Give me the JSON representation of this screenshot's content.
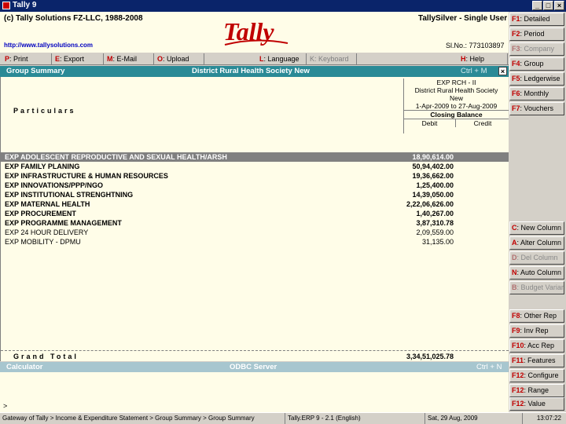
{
  "window": {
    "title": "Tally 9"
  },
  "header": {
    "copyright": "(c) Tally Solutions FZ-LLC, 1988-2008",
    "product": "TallySilver - Single User",
    "website": "http://www.tallysolutions.com",
    "serial": "Sl.No.: 773103897",
    "logo_text": "Tally"
  },
  "menu": [
    {
      "key": "P",
      "label": ": Print",
      "dim": false
    },
    {
      "key": "E",
      "label": ": Export",
      "dim": false
    },
    {
      "key": "M",
      "label": ": E-Mail",
      "dim": false
    },
    {
      "key": "O",
      "label": ": Upload",
      "dim": false
    },
    {
      "key": "L",
      "label": ": Language",
      "dim": false
    },
    {
      "key": "K",
      "label": ": Keyboard",
      "dim": true
    },
    {
      "key": "H",
      "label": ": Help",
      "dim": false
    }
  ],
  "report": {
    "title": "Group Summary",
    "company": "District Rural Health Society New",
    "shortcut": "Ctrl + M",
    "particulars": "Particulars",
    "col_head": {
      "group": "EXP RCH - II",
      "company": "District Rural Health Society New",
      "period": "1-Apr-2009 to 27-Aug-2009",
      "balance_label": "Closing Balance",
      "debit": "Debit",
      "credit": "Credit"
    },
    "rows": [
      {
        "name": "EXP ADOLESCENT REPRODUCTIVE AND SEXUAL HEALTH/ARSH",
        "debit": "18,90,614.00",
        "bold": true,
        "selected": true
      },
      {
        "name": "EXP FAMILY PLANING",
        "debit": "50,94,402.00",
        "bold": true,
        "selected": false
      },
      {
        "name": "EXP INFRASTRUCTURE & HUMAN RESOURCES",
        "debit": "19,36,662.00",
        "bold": true,
        "selected": false
      },
      {
        "name": "EXP INNOVATIONS/PPP/NGO",
        "debit": "1,25,400.00",
        "bold": true,
        "selected": false
      },
      {
        "name": "EXP INSTITUTIONAL STRENGHTNING",
        "debit": "14,39,050.00",
        "bold": true,
        "selected": false
      },
      {
        "name": "EXP MATERNAL HEALTH",
        "debit": "2,22,06,626.00",
        "bold": true,
        "selected": false
      },
      {
        "name": "EXP PROCUREMENT",
        "debit": "1,40,267.00",
        "bold": true,
        "selected": false
      },
      {
        "name": "EXP PROGRAMME MANAGEMENT",
        "debit": "3,87,310.78",
        "bold": true,
        "selected": false
      },
      {
        "name": "EXP 24 HOUR DELIVERY",
        "debit": "2,09,559.00",
        "bold": false,
        "selected": false
      },
      {
        "name": "EXP MOBILITY - DPMU",
        "debit": "31,135.00",
        "bold": false,
        "selected": false
      }
    ],
    "grand_total_label": "Grand Total",
    "grand_total": "3,34,51,025.78"
  },
  "calculator": {
    "title": "Calculator",
    "server": "ODBC Server",
    "shortcut": "Ctrl + N",
    "prompt": ">"
  },
  "status": {
    "path": "Gateway of Tally > Income & Expenditure Statement > Group Summary > Group Summary",
    "version": "Tally.ERP 9 - 2.1 (English)",
    "date": "Sat, 29 Aug, 2009",
    "time": "13:07:22"
  },
  "buttons": [
    {
      "key": "F1",
      "label": ": Detailed",
      "dim": false
    },
    {
      "key": "F2",
      "label": ": Period",
      "dim": false
    },
    {
      "key": "F3",
      "label": ": Company",
      "dim": true
    },
    {
      "key": "F4",
      "label": ": Group",
      "dim": false
    },
    {
      "key": "F5",
      "label": ": Ledgerwise",
      "dim": false
    },
    {
      "key": "F6",
      "label": ": Monthly",
      "dim": false
    },
    {
      "key": "F7",
      "label": ": Vouchers",
      "dim": false
    },
    {
      "key": "C",
      "label": ": New Column",
      "dim": false
    },
    {
      "key": "A",
      "label": ": Alter Column",
      "dim": false
    },
    {
      "key": "D",
      "label": ": Del Column",
      "dim": true
    },
    {
      "key": "N",
      "label": ": Auto Column",
      "dim": false
    },
    {
      "key": "B",
      "label": ": Budget Variance",
      "dim": true
    },
    {
      "key": "F8",
      "label": ": Other Rep",
      "dim": false
    },
    {
      "key": "F9",
      "label": ": Inv Rep",
      "dim": false
    },
    {
      "key": "F10",
      "label": ": Acc Rep",
      "dim": false
    },
    {
      "key": "F11",
      "label": ": Features",
      "dim": false
    },
    {
      "key": "F12",
      "label": ": Configure",
      "dim": false
    },
    {
      "key": "F12",
      "label": ": Range",
      "dim": false
    },
    {
      "key": "F12",
      "label": ": Value",
      "dim": false
    }
  ]
}
